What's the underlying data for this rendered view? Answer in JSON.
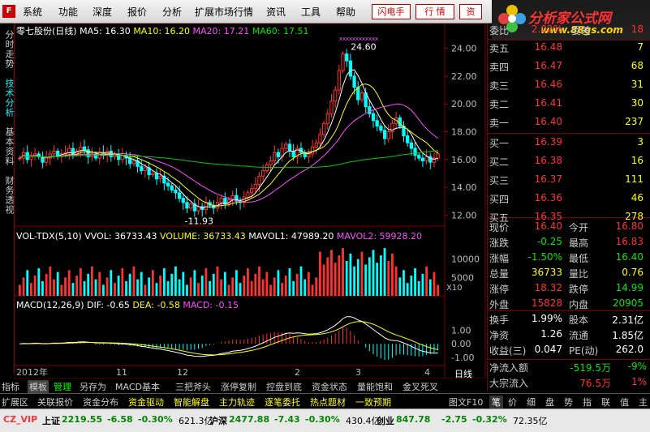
{
  "menu": {
    "items": [
      "系统",
      "功能",
      "深度",
      "报价",
      "分析",
      "扩展市场行情",
      "资讯",
      "工具",
      "帮助"
    ],
    "buttons": [
      "闪电手",
      "行 情",
      "资"
    ]
  },
  "brand": {
    "title": "分析家公式网",
    "url": "www.88gs.com"
  },
  "left_tabs": [
    "分时走势",
    "技术分析",
    "基本资料",
    "财务透视"
  ],
  "chart_header": {
    "name": "零七股份(日线)",
    "ma5": "MA5: 16.30",
    "ma10": "MA10: 16.20",
    "ma20": "MA20: 17.21",
    "ma60": "MA60: 17.51"
  },
  "vol_header": {
    "name": "VOL-TDX(5,10)",
    "vvol": "VVOL: 36733.43",
    "volume": "VOLUME: 36733.43",
    "mavol1": "MAVOL1: 47989.20",
    "mavol2": "MAVOL2: 59928.20"
  },
  "macd_header": {
    "name": "MACD(12,26,9)",
    "dif": "DIF: -0.65",
    "dea": "DEA: -0.58",
    "macd": "MACD: -0.15"
  },
  "period_label": "日线",
  "chart_data": [
    {
      "type": "candlestick",
      "title": "零七股份(日线)",
      "y_ticks": [
        12.0,
        14.0,
        16.0,
        18.0,
        20.0,
        22.0,
        24.0
      ],
      "ylim": [
        11.2,
        24.8
      ],
      "annotations": [
        "24.60",
        "11.93"
      ],
      "x_ticks": [
        "2012年",
        "11",
        "12",
        "2",
        "3",
        "4"
      ],
      "series": [
        {
          "name": "MA5",
          "color": "#ffffff"
        },
        {
          "name": "MA10",
          "color": "#ffff00"
        },
        {
          "name": "MA20",
          "color": "#ff4dff"
        },
        {
          "name": "MA60",
          "color": "#00cc00"
        }
      ],
      "closes": [
        16.1,
        16.5,
        16.0,
        16.3,
        16.4,
        16.2,
        15.8,
        16.1,
        16.4,
        16.6,
        16.2,
        16.4,
        16.5,
        16.8,
        16.4,
        16.6,
        16.9,
        16.7,
        16.2,
        16.4,
        16.1,
        16.5,
        16.3,
        16.6,
        16.2,
        16.4,
        16.0,
        16.3,
        16.1,
        15.7,
        15.9,
        15.5,
        15.2,
        15.4,
        14.9,
        15.0,
        14.6,
        14.8,
        14.3,
        14.1,
        13.8,
        13.6,
        13.2,
        12.9,
        12.5,
        12.8,
        12.3,
        12.6,
        12.4,
        12.9,
        12.7,
        12.5,
        12.9,
        13.2,
        12.8,
        13.1,
        13.4,
        13.0,
        12.9,
        13.3,
        13.6,
        13.9,
        14.2,
        14.8,
        15.2,
        15.6,
        15.9,
        16.5,
        16.2,
        16.8,
        17.1,
        16.6,
        16.2,
        16.8,
        16.5,
        16.2,
        16.4,
        16.9,
        17.2,
        17.8,
        18.6,
        19.3,
        20.2,
        21.0,
        22.4,
        23.6,
        23.1,
        22.0,
        21.2,
        20.3,
        20.8,
        19.8,
        19.3,
        18.8,
        18.4,
        18.1,
        17.5,
        18.0,
        18.6,
        19.0,
        18.4,
        17.7,
        17.2,
        16.8,
        16.3,
        16.1,
        15.9,
        16.2,
        15.8,
        16.1,
        16.4
      ]
    },
    {
      "type": "bar",
      "title": "VOL-TDX(5,10)",
      "y_ticks": [
        5000,
        10000
      ],
      "ylim": [
        0,
        15000
      ],
      "unit": "X10"
    },
    {
      "type": "bar",
      "title": "MACD(12,26,9)",
      "y_ticks": [
        -1.0,
        0.0,
        1.0
      ],
      "ylim": [
        -1.6,
        2.4
      ]
    }
  ],
  "quote": {
    "wb": {
      "label": "委比",
      "value": "2.02%",
      "label2": "委差",
      "value2": "18"
    },
    "asks": [
      {
        "label": "卖五",
        "price": "16.48",
        "vol": "7"
      },
      {
        "label": "卖四",
        "price": "16.47",
        "vol": "68"
      },
      {
        "label": "卖三",
        "price": "16.46",
        "vol": "31"
      },
      {
        "label": "卖二",
        "price": "16.41",
        "vol": "30"
      },
      {
        "label": "卖一",
        "price": "16.40",
        "vol": "237"
      }
    ],
    "bids": [
      {
        "label": "买一",
        "price": "16.39",
        "vol": "3"
      },
      {
        "label": "买二",
        "price": "16.38",
        "vol": "16"
      },
      {
        "label": "买三",
        "price": "16.37",
        "vol": "111"
      },
      {
        "label": "买四",
        "price": "16.36",
        "vol": "46"
      },
      {
        "label": "买五",
        "price": "16.35",
        "vol": "278"
      }
    ],
    "stats": [
      {
        "l1": "现价",
        "v1": "16.40",
        "c1": "up",
        "l2": "今开",
        "v2": "16.80",
        "c2": "up"
      },
      {
        "l1": "涨跌",
        "v1": "-0.25",
        "c1": "dn",
        "l2": "最高",
        "v2": "16.83",
        "c2": "up"
      },
      {
        "l1": "涨幅",
        "v1": "-1.50%",
        "c1": "dn",
        "l2": "最低",
        "v2": "16.40",
        "c2": "dn"
      },
      {
        "l1": "总量",
        "v1": "36733",
        "c1": "yl",
        "l2": "量比",
        "v2": "0.76",
        "c2": "yl"
      },
      {
        "l1": "涨停",
        "v1": "18.32",
        "c1": "up",
        "l2": "跌停",
        "v2": "14.99",
        "c2": "dn"
      },
      {
        "l1": "外盘",
        "v1": "15828",
        "c1": "up",
        "l2": "内盘",
        "v2": "20905",
        "c2": "dn"
      }
    ],
    "stats2": [
      {
        "l1": "换手",
        "v1": "1.99%",
        "l2": "股本",
        "v2": "2.31亿"
      },
      {
        "l1": "净资",
        "v1": "1.26",
        "l2": "流通",
        "v2": "1.85亿"
      },
      {
        "l1": "收益(三)",
        "v1": "0.047",
        "l2": "PE(动)",
        "v2": "262.0"
      }
    ],
    "flow": [
      {
        "label": "净流入额",
        "value": "-519.5万",
        "pct": "-9%",
        "color": "dn"
      },
      {
        "label": "大宗流入",
        "value": "76.5万",
        "pct": "1%",
        "color": "up"
      }
    ]
  },
  "bottom_tabs": [
    "指标",
    "模板",
    "管理",
    "另存为",
    "MACD基本",
    "三把斧头",
    "涨停复制",
    "控盘到底",
    "资金状态",
    "量能饱和",
    "金叉死叉"
  ],
  "bar2": [
    "扩展区",
    "关联报价",
    "资金分布",
    "资金驱动",
    "智能解盘",
    "主力轨迹",
    "逐笔委托",
    "热点题材",
    "一致预期"
  ],
  "right_tabs": [
    "图文F10",
    "笔",
    "价",
    "细",
    "盘",
    "势",
    "指",
    "联",
    "值",
    "主"
  ],
  "status": [
    {
      "name": "CZ_VIP",
      "cls": "up"
    },
    {
      "name": "上证",
      "value": "2219.55",
      "chg": "-6.58",
      "pct": "-0.30%",
      "amt": "621.3亿"
    },
    {
      "name": "沪深",
      "value": "2477.88",
      "chg": "-7.43",
      "pct": "-0.30%",
      "amt": "430.4亿"
    },
    {
      "name": "创业",
      "value": "847.78",
      "chg": "-2.75",
      "pct": "-0.32%",
      "amt": "72.35亿"
    }
  ]
}
